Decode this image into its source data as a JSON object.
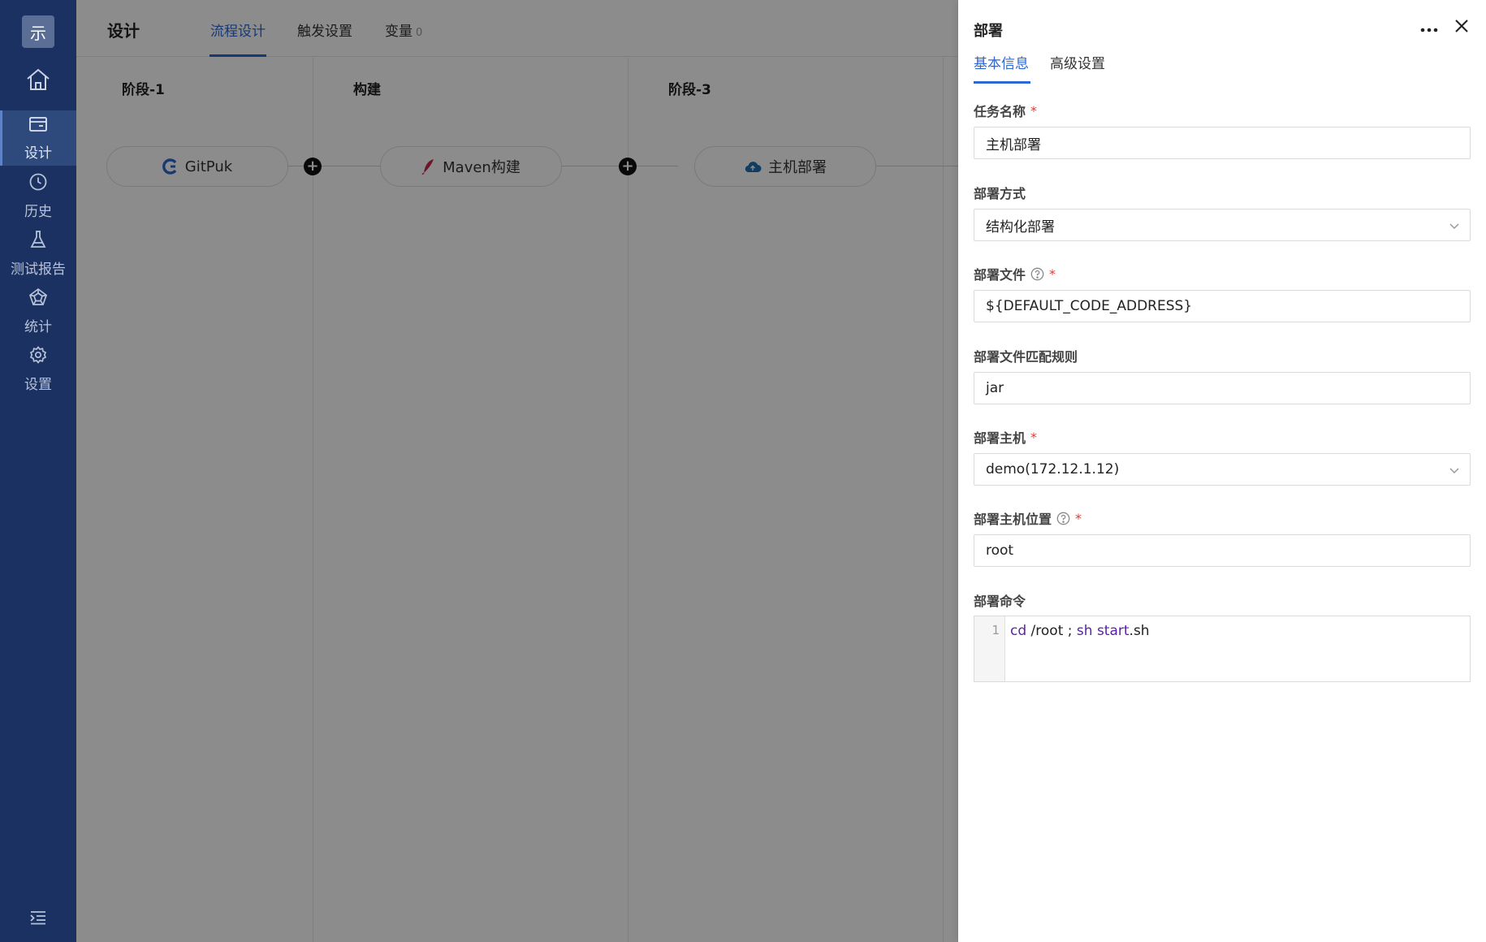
{
  "sidebar": {
    "logo_text": "示",
    "items": [
      {
        "label": "设计",
        "icon": "card-icon",
        "active": true
      },
      {
        "label": "历史",
        "icon": "clock-icon",
        "active": false
      },
      {
        "label": "测试报告",
        "icon": "flask-icon",
        "active": false
      },
      {
        "label": "统计",
        "icon": "pentagon-chart-icon",
        "active": false
      },
      {
        "label": "设置",
        "icon": "gear-icon",
        "active": false
      }
    ]
  },
  "header": {
    "title": "设计",
    "tabs": [
      {
        "label": "流程设计",
        "active": true
      },
      {
        "label": "触发设置",
        "active": false
      },
      {
        "label": "变量",
        "count": "0",
        "active": false
      }
    ]
  },
  "pipeline": {
    "stages": [
      {
        "title": "阶段-1",
        "job": "GitPuk",
        "icon": "gitpuk-icon"
      },
      {
        "title": "构建",
        "job": "Maven构建",
        "icon": "maven-feather-icon"
      },
      {
        "title": "阶段-3",
        "job": "主机部署",
        "icon": "cloud-icon"
      }
    ],
    "add_symbol": "+"
  },
  "drawer": {
    "title": "部署",
    "tabs": [
      {
        "label": "基本信息",
        "active": true
      },
      {
        "label": "高级设置",
        "active": false
      }
    ],
    "required_mark": "*",
    "fields": {
      "task_name": {
        "label": "任务名称",
        "value": "主机部署"
      },
      "deploy_mode": {
        "label": "部署方式",
        "value": "结构化部署"
      },
      "deploy_file": {
        "label": "部署文件",
        "value": "${DEFAULT_CODE_ADDRESS}"
      },
      "file_rule": {
        "label": "部署文件匹配规则",
        "value": "jar"
      },
      "deploy_host": {
        "label": "部署主机",
        "value": "demo(172.12.1.12)"
      },
      "host_path": {
        "label": "部署主机位置",
        "value": "root"
      },
      "deploy_cmd": {
        "label": "部署命令",
        "line_no": "1",
        "tokens": {
          "t1": "cd",
          "t2": " /root ; ",
          "t3": "sh",
          "t4": " ",
          "t5": "start",
          "t6": ".sh"
        }
      }
    }
  },
  "colors": {
    "sidebar_bg": "#1b3161",
    "accent": "#2c67d4",
    "required": "#e53935",
    "keyword": "#5a1fa8"
  }
}
